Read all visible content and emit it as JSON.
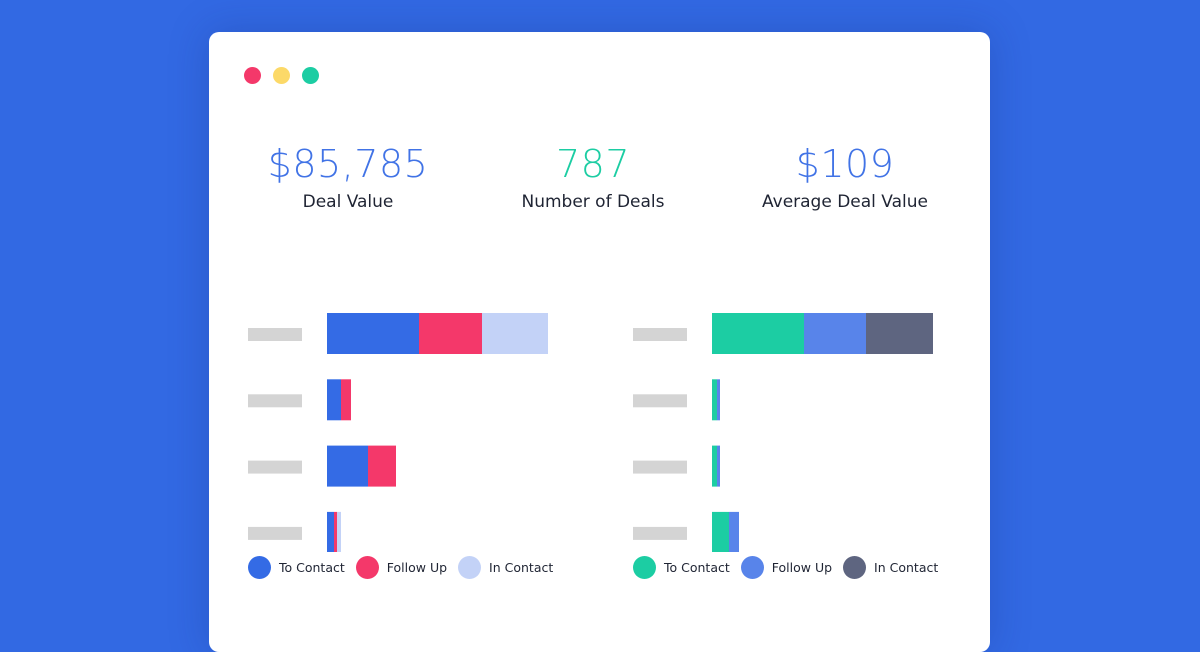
{
  "window": {
    "controls": [
      {
        "name": "close",
        "color": "#f4386a"
      },
      {
        "name": "minimize",
        "color": "#fcd968"
      },
      {
        "name": "maximize",
        "color": "#1ccda3"
      }
    ]
  },
  "kpis": [
    {
      "value": "$85,785",
      "label": "Deal Value",
      "color": "#4173e6"
    },
    {
      "value": "787",
      "label": "Number of Deals",
      "color": "#1ccda3"
    },
    {
      "value": "$109",
      "label": "Average Deal Value",
      "color": "#4173e6"
    }
  ],
  "chart_data": [
    {
      "type": "bar",
      "orientation": "horizontal",
      "stacked": true,
      "title": "",
      "xlabel": "",
      "ylabel": "",
      "categories": [
        "",
        "",
        "",
        ""
      ],
      "category_labels_placeholder": true,
      "xlim": [
        0,
        230
      ],
      "grid": false,
      "legend_position": "bottom-left",
      "series": [
        {
          "name": "To Contact",
          "color": "#346be5",
          "values": [
            92,
            14,
            41,
            7
          ]
        },
        {
          "name": "Follow Up",
          "color": "#f4386a",
          "values": [
            63,
            10,
            28,
            3
          ]
        },
        {
          "name": "In Contact",
          "color": "#c3d2f7",
          "values": [
            66,
            0,
            0,
            4
          ]
        }
      ]
    },
    {
      "type": "bar",
      "orientation": "horizontal",
      "stacked": true,
      "title": "",
      "xlabel": "",
      "ylabel": "",
      "categories": [
        "",
        "",
        "",
        ""
      ],
      "category_labels_placeholder": true,
      "xlim": [
        0,
        230
      ],
      "grid": false,
      "legend_position": "bottom-left",
      "series": [
        {
          "name": "To Contact",
          "color": "#1ccda3",
          "values": [
            92,
            5,
            5,
            17
          ]
        },
        {
          "name": "Follow Up",
          "color": "#5884ea",
          "values": [
            62,
            3,
            3,
            10
          ]
        },
        {
          "name": "In Contact",
          "color": "#5e6580",
          "values": [
            67,
            0,
            0,
            0
          ]
        }
      ]
    }
  ],
  "placeholder_color": "#d4d4d4"
}
